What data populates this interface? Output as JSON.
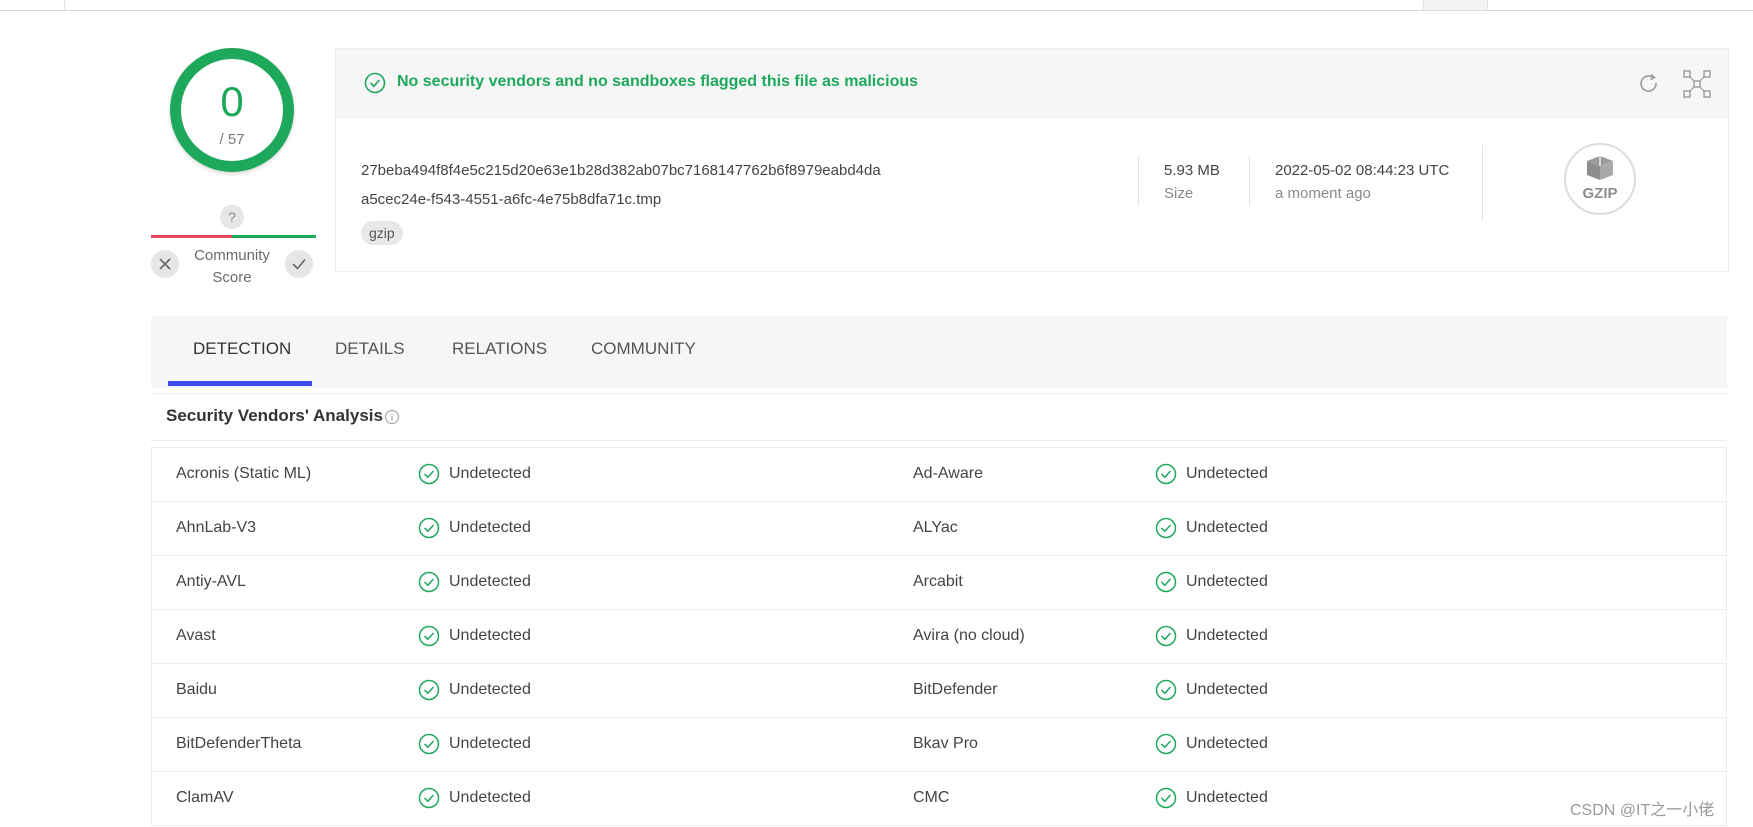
{
  "score": {
    "detections": "0",
    "total": "/ 57"
  },
  "community": {
    "question": "?",
    "label_line1": "Community",
    "label_line2": "Score",
    "downvote_icon": "x-icon",
    "upvote_icon": "check-icon"
  },
  "summary": {
    "headline": "No security vendors and no sandboxes flagged this file as malicious",
    "hash": "27beba494f8f4e5c215d20e63e1b28d382ab07bc7168147762b6f8979eabd4da",
    "filename": "a5cec24e-f543-4551-a6fc-4e75b8dfa71c.tmp",
    "tag": "gzip",
    "size_value": "5.93 MB",
    "size_label": "Size",
    "date_value": "2022-05-02 08:44:23 UTC",
    "date_relative": "a moment ago",
    "filetype_badge": "GZIP"
  },
  "tabs": [
    {
      "label": "DETECTION",
      "active": true
    },
    {
      "label": "DETAILS"
    },
    {
      "label": "RELATIONS"
    },
    {
      "label": "COMMUNITY"
    }
  ],
  "analysis": {
    "title": "Security Vendors' Analysis",
    "rows": [
      {
        "left": {
          "vendor": "Acronis (Static ML)",
          "result": "Undetected"
        },
        "right": {
          "vendor": "Ad-Aware",
          "result": "Undetected"
        }
      },
      {
        "left": {
          "vendor": "AhnLab-V3",
          "result": "Undetected"
        },
        "right": {
          "vendor": "ALYac",
          "result": "Undetected"
        }
      },
      {
        "left": {
          "vendor": "Antiy-AVL",
          "result": "Undetected"
        },
        "right": {
          "vendor": "Arcabit",
          "result": "Undetected"
        }
      },
      {
        "left": {
          "vendor": "Avast",
          "result": "Undetected"
        },
        "right": {
          "vendor": "Avira (no cloud)",
          "result": "Undetected"
        }
      },
      {
        "left": {
          "vendor": "Baidu",
          "result": "Undetected"
        },
        "right": {
          "vendor": "BitDefender",
          "result": "Undetected"
        }
      },
      {
        "left": {
          "vendor": "BitDefenderTheta",
          "result": "Undetected"
        },
        "right": {
          "vendor": "Bkav Pro",
          "result": "Undetected"
        }
      },
      {
        "left": {
          "vendor": "ClamAV",
          "result": "Undetected"
        },
        "right": {
          "vendor": "CMC",
          "result": "Undetected"
        }
      }
    ]
  },
  "colors": {
    "clean": "#1ea85c",
    "malicious": "#e5475e",
    "tab_accent": "#3b4cf0"
  },
  "watermark": "CSDN @IT之一小佬"
}
